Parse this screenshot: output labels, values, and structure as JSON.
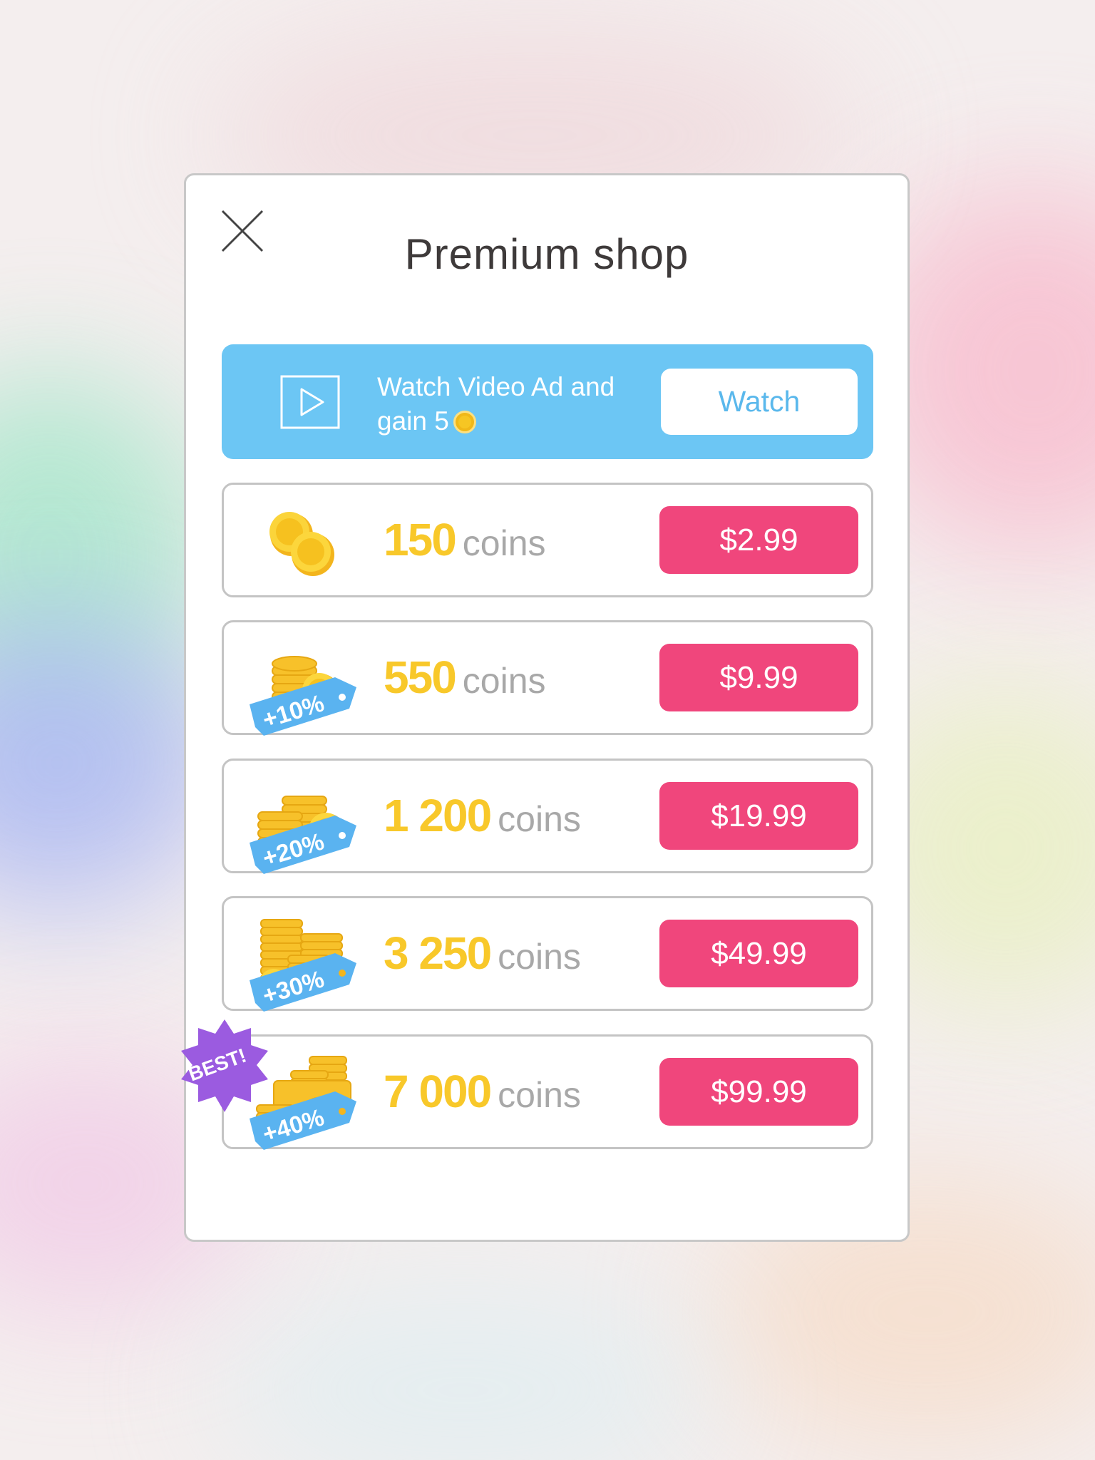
{
  "dialog": {
    "title": "Premium shop",
    "close_icon": "close-icon"
  },
  "video_ad": {
    "icon": "play-video-icon",
    "text": "Watch Video Ad and gain 5",
    "reward_icon": "coin-icon",
    "button_label": "Watch",
    "color": "#6cc6f4"
  },
  "offers": [
    {
      "amount": "150",
      "unit": "coins",
      "price": "$2.99",
      "bonus": "",
      "icon": "coin-pair-icon"
    },
    {
      "amount": "550",
      "unit": "coins",
      "price": "$9.99",
      "bonus": "+10%",
      "icon": "coin-stack-icon"
    },
    {
      "amount": "1 200",
      "unit": "coins",
      "price": "$19.99",
      "bonus": "+20%",
      "icon": "coin-stacks-icon"
    },
    {
      "amount": "3 250",
      "unit": "coins",
      "price": "$49.99",
      "bonus": "+30%",
      "icon": "coin-towers-icon"
    },
    {
      "amount": "7 000",
      "unit": "coins",
      "price": "$99.99",
      "bonus": "+40%",
      "icon": "coin-chest-icon",
      "badge": "BEST!"
    }
  ],
  "colors": {
    "price_button": "#f0467c",
    "amount_text": "#f8c82a",
    "bonus_tag": "#5ab3f0",
    "best_badge": "#9b5be0"
  }
}
